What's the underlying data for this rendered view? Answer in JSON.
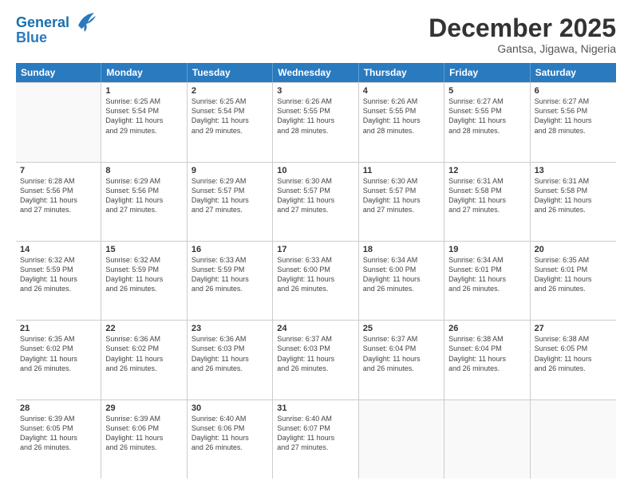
{
  "logo": {
    "line1": "General",
    "line2": "Blue"
  },
  "title": "December 2025",
  "location": "Gantsa, Jigawa, Nigeria",
  "days_of_week": [
    "Sunday",
    "Monday",
    "Tuesday",
    "Wednesday",
    "Thursday",
    "Friday",
    "Saturday"
  ],
  "weeks": [
    [
      {
        "day": "",
        "info": ""
      },
      {
        "day": "1",
        "info": "Sunrise: 6:25 AM\nSunset: 5:54 PM\nDaylight: 11 hours\nand 29 minutes."
      },
      {
        "day": "2",
        "info": "Sunrise: 6:25 AM\nSunset: 5:54 PM\nDaylight: 11 hours\nand 29 minutes."
      },
      {
        "day": "3",
        "info": "Sunrise: 6:26 AM\nSunset: 5:55 PM\nDaylight: 11 hours\nand 28 minutes."
      },
      {
        "day": "4",
        "info": "Sunrise: 6:26 AM\nSunset: 5:55 PM\nDaylight: 11 hours\nand 28 minutes."
      },
      {
        "day": "5",
        "info": "Sunrise: 6:27 AM\nSunset: 5:55 PM\nDaylight: 11 hours\nand 28 minutes."
      },
      {
        "day": "6",
        "info": "Sunrise: 6:27 AM\nSunset: 5:56 PM\nDaylight: 11 hours\nand 28 minutes."
      }
    ],
    [
      {
        "day": "7",
        "info": "Sunrise: 6:28 AM\nSunset: 5:56 PM\nDaylight: 11 hours\nand 27 minutes."
      },
      {
        "day": "8",
        "info": "Sunrise: 6:29 AM\nSunset: 5:56 PM\nDaylight: 11 hours\nand 27 minutes."
      },
      {
        "day": "9",
        "info": "Sunrise: 6:29 AM\nSunset: 5:57 PM\nDaylight: 11 hours\nand 27 minutes."
      },
      {
        "day": "10",
        "info": "Sunrise: 6:30 AM\nSunset: 5:57 PM\nDaylight: 11 hours\nand 27 minutes."
      },
      {
        "day": "11",
        "info": "Sunrise: 6:30 AM\nSunset: 5:57 PM\nDaylight: 11 hours\nand 27 minutes."
      },
      {
        "day": "12",
        "info": "Sunrise: 6:31 AM\nSunset: 5:58 PM\nDaylight: 11 hours\nand 27 minutes."
      },
      {
        "day": "13",
        "info": "Sunrise: 6:31 AM\nSunset: 5:58 PM\nDaylight: 11 hours\nand 26 minutes."
      }
    ],
    [
      {
        "day": "14",
        "info": "Sunrise: 6:32 AM\nSunset: 5:59 PM\nDaylight: 11 hours\nand 26 minutes."
      },
      {
        "day": "15",
        "info": "Sunrise: 6:32 AM\nSunset: 5:59 PM\nDaylight: 11 hours\nand 26 minutes."
      },
      {
        "day": "16",
        "info": "Sunrise: 6:33 AM\nSunset: 5:59 PM\nDaylight: 11 hours\nand 26 minutes."
      },
      {
        "day": "17",
        "info": "Sunrise: 6:33 AM\nSunset: 6:00 PM\nDaylight: 11 hours\nand 26 minutes."
      },
      {
        "day": "18",
        "info": "Sunrise: 6:34 AM\nSunset: 6:00 PM\nDaylight: 11 hours\nand 26 minutes."
      },
      {
        "day": "19",
        "info": "Sunrise: 6:34 AM\nSunset: 6:01 PM\nDaylight: 11 hours\nand 26 minutes."
      },
      {
        "day": "20",
        "info": "Sunrise: 6:35 AM\nSunset: 6:01 PM\nDaylight: 11 hours\nand 26 minutes."
      }
    ],
    [
      {
        "day": "21",
        "info": "Sunrise: 6:35 AM\nSunset: 6:02 PM\nDaylight: 11 hours\nand 26 minutes."
      },
      {
        "day": "22",
        "info": "Sunrise: 6:36 AM\nSunset: 6:02 PM\nDaylight: 11 hours\nand 26 minutes."
      },
      {
        "day": "23",
        "info": "Sunrise: 6:36 AM\nSunset: 6:03 PM\nDaylight: 11 hours\nand 26 minutes."
      },
      {
        "day": "24",
        "info": "Sunrise: 6:37 AM\nSunset: 6:03 PM\nDaylight: 11 hours\nand 26 minutes."
      },
      {
        "day": "25",
        "info": "Sunrise: 6:37 AM\nSunset: 6:04 PM\nDaylight: 11 hours\nand 26 minutes."
      },
      {
        "day": "26",
        "info": "Sunrise: 6:38 AM\nSunset: 6:04 PM\nDaylight: 11 hours\nand 26 minutes."
      },
      {
        "day": "27",
        "info": "Sunrise: 6:38 AM\nSunset: 6:05 PM\nDaylight: 11 hours\nand 26 minutes."
      }
    ],
    [
      {
        "day": "28",
        "info": "Sunrise: 6:39 AM\nSunset: 6:05 PM\nDaylight: 11 hours\nand 26 minutes."
      },
      {
        "day": "29",
        "info": "Sunrise: 6:39 AM\nSunset: 6:06 PM\nDaylight: 11 hours\nand 26 minutes."
      },
      {
        "day": "30",
        "info": "Sunrise: 6:40 AM\nSunset: 6:06 PM\nDaylight: 11 hours\nand 26 minutes."
      },
      {
        "day": "31",
        "info": "Sunrise: 6:40 AM\nSunset: 6:07 PM\nDaylight: 11 hours\nand 27 minutes."
      },
      {
        "day": "",
        "info": ""
      },
      {
        "day": "",
        "info": ""
      },
      {
        "day": "",
        "info": ""
      }
    ]
  ]
}
